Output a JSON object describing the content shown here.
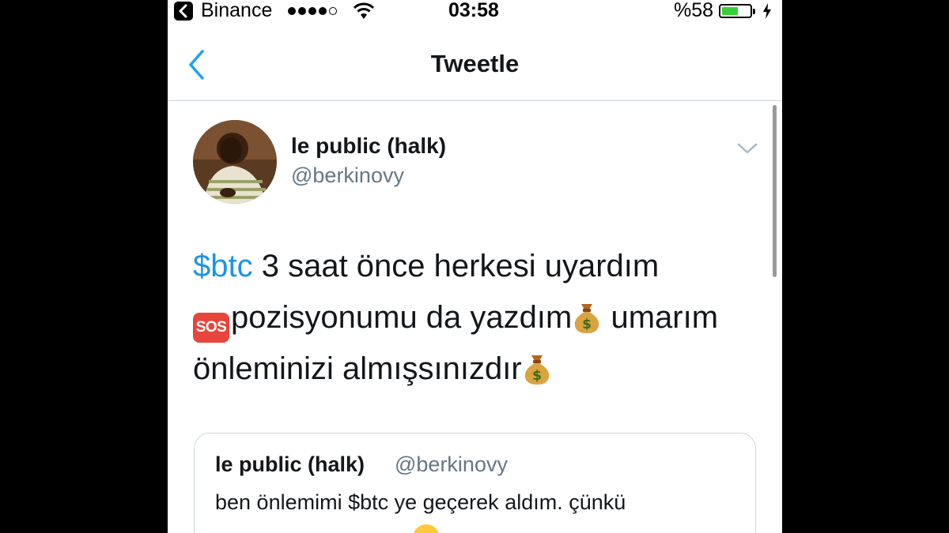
{
  "status_bar": {
    "back_app": "Binance",
    "time": "03:58",
    "battery_percent": "%58",
    "battery_level": 0.58,
    "signal_bars_filled": 4,
    "signal_bars_total": 5
  },
  "nav": {
    "title": "Tweetle"
  },
  "tweet": {
    "display_name": "le public (halk)",
    "handle": "@berkinovy",
    "cashtag": "$btc",
    "text_1": " 3 saat önce herkesi uyardım",
    "sos_label": "SOS",
    "text_2": "pozisyonumu da yazdım",
    "text_3": " umarım önleminizi almışsınızdır"
  },
  "quoted_tweet": {
    "display_name": "le public (halk)",
    "handle": "@berkinovy",
    "text": "ben önlemimi $btc ye geçerek aldım. çünkü"
  },
  "colors": {
    "link": "#1b95e0",
    "secondary_text": "#657786",
    "battery_fill": "#36d03b",
    "sos_red": "#e8453c"
  }
}
